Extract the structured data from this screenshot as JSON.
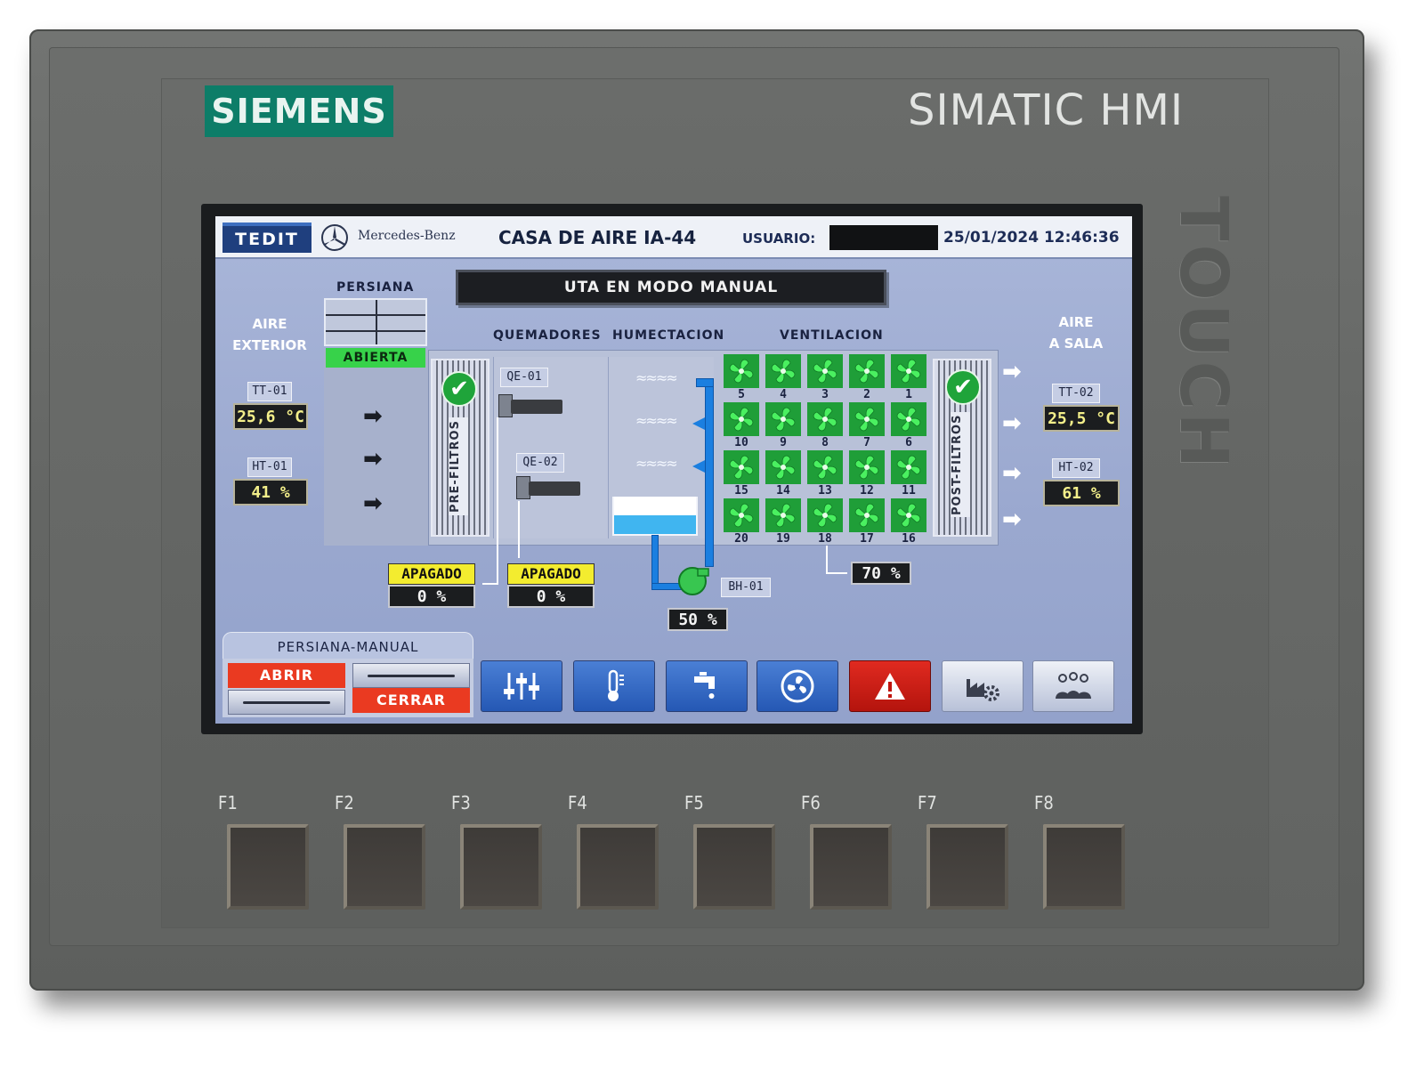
{
  "device": {
    "brand": "SIEMENS",
    "product": "SIMATIC HMI",
    "side_label": "TOUCH",
    "function_keys": [
      "F1",
      "F2",
      "F3",
      "F4",
      "F5",
      "F6",
      "F7",
      "F8"
    ]
  },
  "header": {
    "company_logo": "TEDIT",
    "partner_logo": "Mercedes-Benz",
    "title": "CASA DE AIRE IA-44",
    "user_label": "USUARIO:",
    "user_value": "",
    "datetime": "25/01/2024 12:46:36"
  },
  "mode_banner": "UTA EN MODO MANUAL",
  "outside": {
    "label_line1": "AIRE",
    "label_line2": "EXTERIOR",
    "temp_tag": "TT-01",
    "temp_value": "25,6 °C",
    "hum_tag": "HT-01",
    "hum_value": "41 %"
  },
  "damper": {
    "label": "PERSIANA",
    "state": "ABIERTA"
  },
  "sections": {
    "burners": "QUEMADORES",
    "humidification": "HUMECTACION",
    "ventilation": "VENTILACION"
  },
  "filters": {
    "pre": "PRE-FILTROS",
    "post": "POST-FILTROS"
  },
  "burners": [
    {
      "tag": "QE-01",
      "status": "APAGADO",
      "value": "0  %"
    },
    {
      "tag": "QE-02",
      "status": "APAGADO",
      "value": "0  %"
    }
  ],
  "humidifier": {
    "pump_tag": "BH-01",
    "value": "50 %"
  },
  "fans": {
    "rows": [
      [
        "5",
        "4",
        "3",
        "2",
        "1"
      ],
      [
        "10",
        "9",
        "8",
        "7",
        "6"
      ],
      [
        "15",
        "14",
        "13",
        "12",
        "11"
      ],
      [
        "20",
        "19",
        "18",
        "17",
        "16"
      ]
    ],
    "speed": "70 %"
  },
  "supply": {
    "label_line1": "AIRE",
    "label_line2": "A SALA",
    "temp_tag": "TT-02",
    "temp_value": "25,5 °C",
    "hum_tag": "HT-02",
    "hum_value": "61 %"
  },
  "manual_damper": {
    "tab": "PERSIANA-MANUAL",
    "open": "ABRIR",
    "close": "CERRAR"
  },
  "nav": [
    {
      "icon": "sliders-icon"
    },
    {
      "icon": "thermometer-icon"
    },
    {
      "icon": "faucet-icon"
    },
    {
      "icon": "fan-icon"
    },
    {
      "icon": "alarm-warning-icon"
    },
    {
      "icon": "factory-settings-icon"
    },
    {
      "icon": "users-icon"
    }
  ],
  "colors": {
    "siemens_green": "#0d7d68",
    "screen_bg": "#9aa8cf",
    "fan_green": "#2fd04a",
    "alarm_red": "#e02a20",
    "status_yellow": "#f3ec2f",
    "damper_open_green": "#37d24a",
    "water_blue": "#1b7fe0"
  }
}
